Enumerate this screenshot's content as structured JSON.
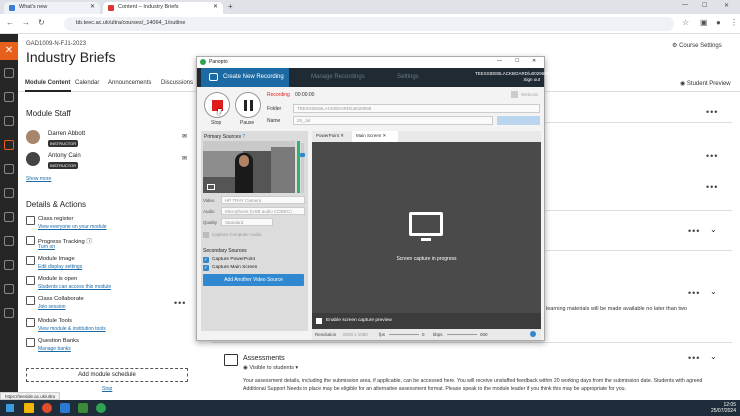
{
  "browser": {
    "tabs": [
      {
        "label": "What's new",
        "color": "#3b7ed8"
      },
      {
        "label": "Content – Industry Briefs",
        "color": "#d8382d"
      }
    ],
    "url": "bb.teec.ac.uk/ultra/courses/_14064_1/outline"
  },
  "course": {
    "code": "GAD1009-N-FJ1-2023",
    "title": "Industry Briefs",
    "settings_label": "Course Settings",
    "tabs": [
      "Module Content",
      "Calendar",
      "Announcements",
      "Discussions"
    ],
    "student_preview": "Student Preview"
  },
  "staff": {
    "heading": "Module Staff",
    "people": [
      {
        "name": "Darren Abbott",
        "role": "INSTRUCTOR"
      },
      {
        "name": "Antony Cain",
        "role": "INSTRUCTOR"
      }
    ],
    "show_more": "Show more"
  },
  "details": {
    "heading": "Details & Actions",
    "items": [
      {
        "title": "Class register",
        "link": "View everyone on your module"
      },
      {
        "title": "Progress Tracking",
        "link": "Turn on"
      },
      {
        "title": "Module Image",
        "link": "Edit display settings"
      },
      {
        "title": "Module is open",
        "link": "Students can access this module"
      },
      {
        "title": "Class Collaborate",
        "link": "Join session"
      },
      {
        "title": "Module Tools",
        "link": "View module & institution tools"
      },
      {
        "title": "Question Banks",
        "link": "Manage banks"
      }
    ],
    "add_schedule": "Add module schedule",
    "stop_label": "Stop"
  },
  "content": {
    "partial_text": "learning materials will be made available no later than two",
    "assessments_title": "Assessments",
    "assessments_visibility": "Visible to students",
    "assessments_desc": "Your assessment details, including the submission area, if applicable, can be accessed here. You will receive unstaffed feedback within 20 working days from the submission date. Students with agreed Additional Support Needs in place may be eligible for an alternative assessment format. Please speak to the module leader if you think this may be appropriate for you."
  },
  "panopto": {
    "window_title": "Panopto",
    "tabs": [
      "Create New Recording",
      "Manage Recordings",
      "Settings"
    ],
    "server_line1": "TEESSIDEBLACKBOARD\\u0029598",
    "server_line2": "Sign out",
    "recording_label": "Recording",
    "recording_time": "00:00:00",
    "stop": "Stop",
    "pause": "Pause",
    "webcast": "Webcast",
    "folder_label": "Folder",
    "folder_value": "TEESSIDEBLACKBOARD\\u0029598",
    "name_label": "Name",
    "name_value": "25_Jul",
    "primary_sources": "Primary Sources",
    "video_label": "Video",
    "video_value": "HP TRAY Camera",
    "audio_label": "Audio",
    "audio_value": "Microphone (USB audio CODEC)",
    "quality_label": "Quality",
    "quality_value": "Standard",
    "capture_computer_audio": "Capture Computer Audio",
    "secondary_sources": "Secondary Sources",
    "cap_powerpoint": "Capture PowerPoint",
    "cap_main_screen": "Capture Main Screen",
    "add_video_source": "Add Another Video Source",
    "capture_tabs": [
      "PowerPoint",
      "Main Screen"
    ],
    "capture_message": "Screen capture in progress",
    "enable_preview": "Enable screen capture preview",
    "status_resolution": "Resolution",
    "status_res_value": "5000 x 1080",
    "status_fps": "fps",
    "status_fps_value": "0",
    "status_kbps": "kbps",
    "status_kbps_value": "000"
  },
  "statusbar_url": "https://teeside.ac.uk/ultra",
  "clock": {
    "time": "12:05",
    "date": "25/07/2024"
  }
}
